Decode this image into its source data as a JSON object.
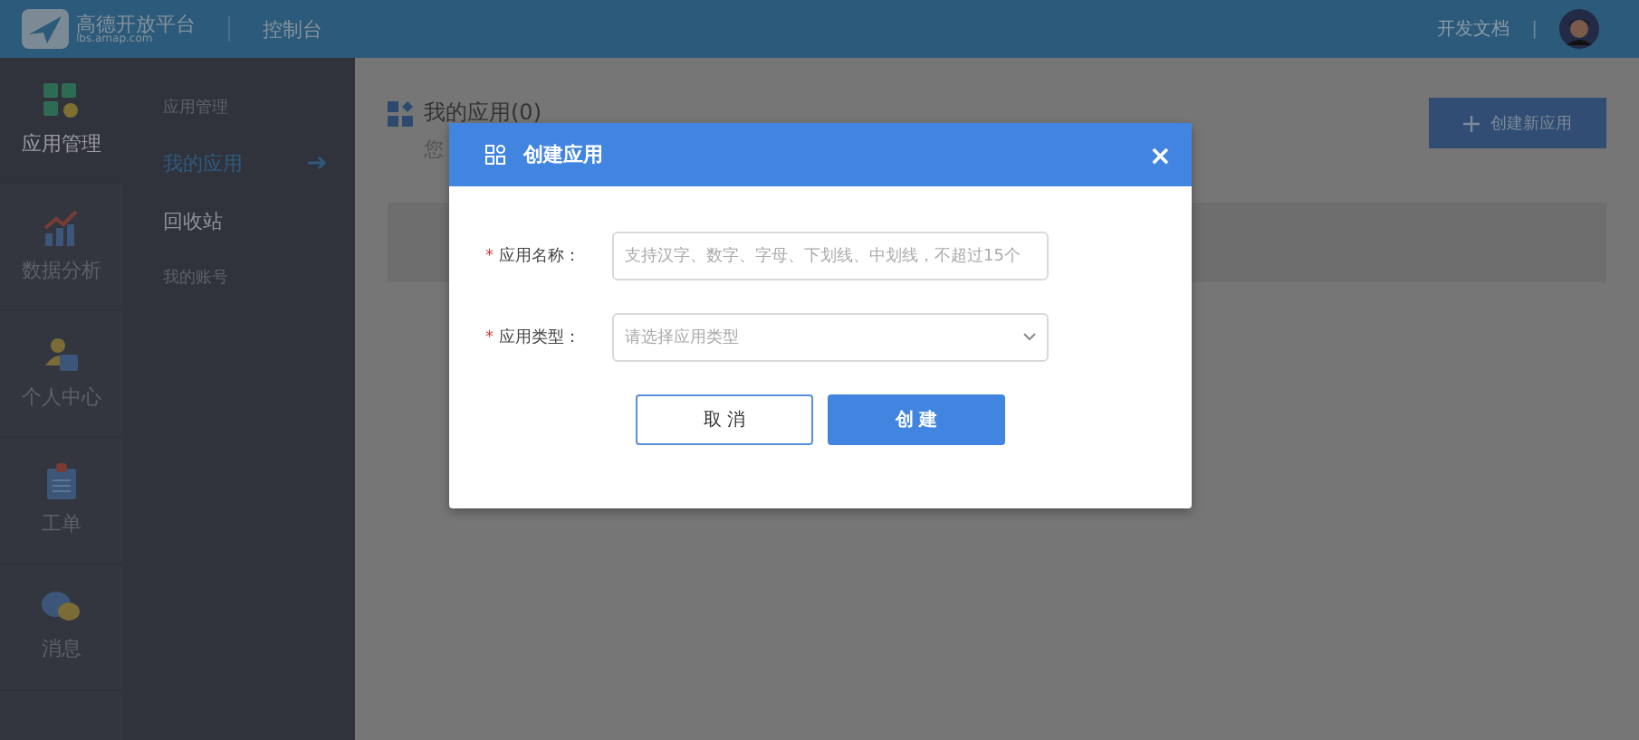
{
  "header": {
    "logo_title": "高德开放平台",
    "logo_subtitle": "lbs.amap.com",
    "console": "控制台",
    "docs_link": "开发文档",
    "divider": "|"
  },
  "nav": [
    {
      "label": "应用管理",
      "selected": true
    },
    {
      "label": "数据分析",
      "selected": false
    },
    {
      "label": "个人中心",
      "selected": false
    },
    {
      "label": "工单",
      "selected": false
    },
    {
      "label": "消息",
      "selected": false
    }
  ],
  "subnav": [
    {
      "kind": "heading",
      "label": "应用管理"
    },
    {
      "kind": "link",
      "label": "我的应用",
      "selected": true
    },
    {
      "kind": "link",
      "label": "回收站",
      "selected": false
    },
    {
      "kind": "heading",
      "label": "我的账号"
    }
  ],
  "main": {
    "title": "我的应用(0)",
    "subtitle": "您",
    "create_button": "创建新应用"
  },
  "dialog": {
    "title": "创建应用",
    "close": "×",
    "fields": [
      {
        "kind": "text",
        "required_mark": "*",
        "label": "应用名称：",
        "placeholder": "支持汉字、数字、字母、下划线、中划线，不超过15个"
      },
      {
        "kind": "select",
        "required_mark": "*",
        "label": "应用类型：",
        "placeholder": "请选择应用类型"
      }
    ],
    "cancel": "取 消",
    "submit": "创 建"
  }
}
